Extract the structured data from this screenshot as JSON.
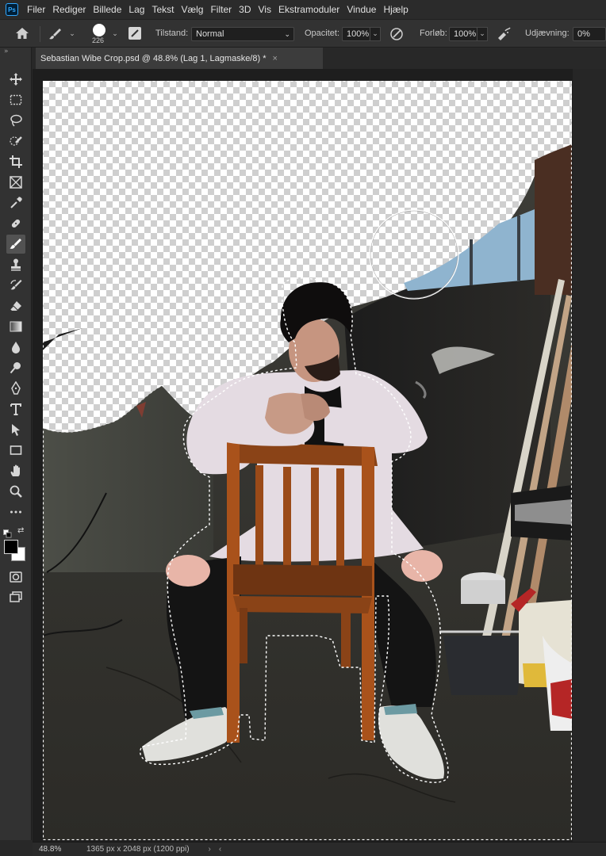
{
  "app": {
    "logo": "Ps"
  },
  "menu": [
    "Filer",
    "Rediger",
    "Billede",
    "Lag",
    "Tekst",
    "Vælg",
    "Filter",
    "3D",
    "Vis",
    "Ekstramoduler",
    "Vindue",
    "Hjælp"
  ],
  "options": {
    "brush_size": "226",
    "mode_label": "Tilstand:",
    "mode_value": "Normal",
    "opacity_label": "Opacitet:",
    "opacity_value": "100%",
    "flow_label": "Forløb:",
    "flow_value": "100%",
    "smoothing_label": "Udjævning:",
    "smoothing_value": "0%"
  },
  "document": {
    "tab_title": "Sebastian Wibe Crop.psd @ 48.8% (Lag 1, Lagmaske/8) *",
    "close_glyph": "×"
  },
  "toolbar": {
    "collapse_glyph": "»",
    "tools": [
      "move-tool-icon",
      "rect-marquee-tool-icon",
      "lasso-tool-icon",
      "quick-select-tool-icon",
      "crop-tool-icon",
      "frame-tool-icon",
      "eyedropper-tool-icon",
      "healing-brush-tool-icon",
      "brush-tool-icon",
      "clone-stamp-tool-icon",
      "history-brush-tool-icon",
      "eraser-tool-icon",
      "gradient-tool-icon",
      "blur-tool-icon",
      "dodge-tool-icon",
      "pen-tool-icon",
      "type-tool-icon",
      "path-select-tool-icon",
      "rectangle-tool-icon",
      "hand-tool-icon",
      "zoom-tool-icon",
      "more-tools-icon"
    ],
    "active_tool": "brush-tool-icon",
    "foreground_color": "#000000",
    "background_color": "#ffffff"
  },
  "status": {
    "zoom": "48.8%",
    "doc_size": "1365 px x 2048 px (1200 ppi)",
    "arrow": "›",
    "prev": "‹"
  }
}
